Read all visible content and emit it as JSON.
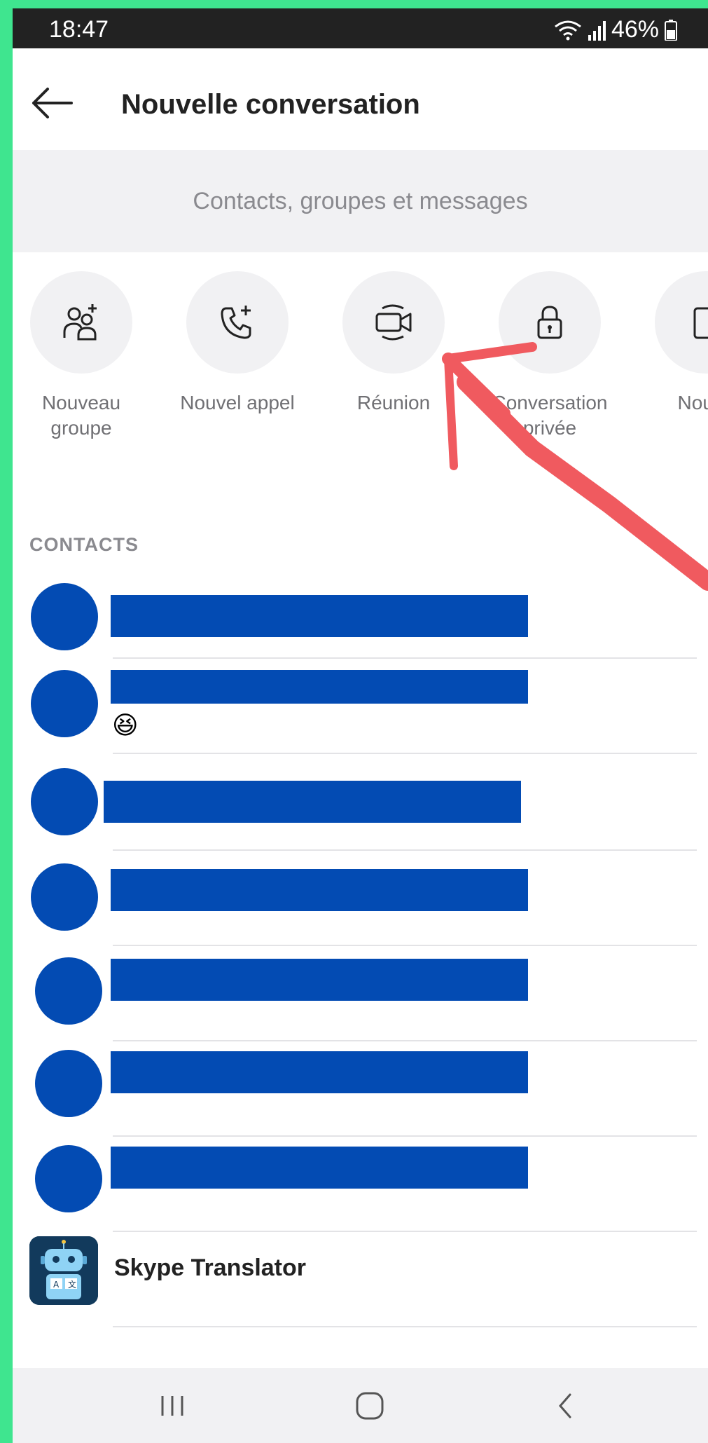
{
  "status_bar": {
    "time": "18:47",
    "battery": "46%",
    "icons": [
      "wifi-icon",
      "signal-icon",
      "battery-icon"
    ]
  },
  "header": {
    "title": "Nouvelle conversation",
    "back_icon": "arrow-left-icon"
  },
  "search": {
    "placeholder": "Contacts, groupes et messages"
  },
  "actions": [
    {
      "label": "Nouveau groupe",
      "icon": "group-add-icon"
    },
    {
      "label": "Nouvel appel",
      "icon": "phone-add-icon"
    },
    {
      "label": "Réunion",
      "icon": "video-meeting-icon"
    },
    {
      "label": "Conversation privée",
      "icon": "lock-icon"
    },
    {
      "label": "Nouve",
      "icon": "device-icon"
    }
  ],
  "contacts": {
    "section_title": "CONTACTS",
    "items": [
      {
        "emoji": ""
      },
      {
        "emoji": "😆"
      },
      {
        "emoji": ""
      },
      {
        "emoji": ""
      },
      {
        "emoji": ""
      },
      {
        "emoji": ""
      },
      {
        "emoji": ""
      }
    ],
    "translator": {
      "name": "Skype Translator",
      "icon": "robot-translator-icon"
    }
  },
  "colors": {
    "frame": "#3fe58f",
    "redaction": "#034bb3",
    "annotation_arrow": "#f05a5f",
    "status_bar": "#222222",
    "surface": "#f1f1f3"
  },
  "navbar": {
    "icons": [
      "recents-icon",
      "home-icon",
      "back-nav-icon"
    ]
  }
}
